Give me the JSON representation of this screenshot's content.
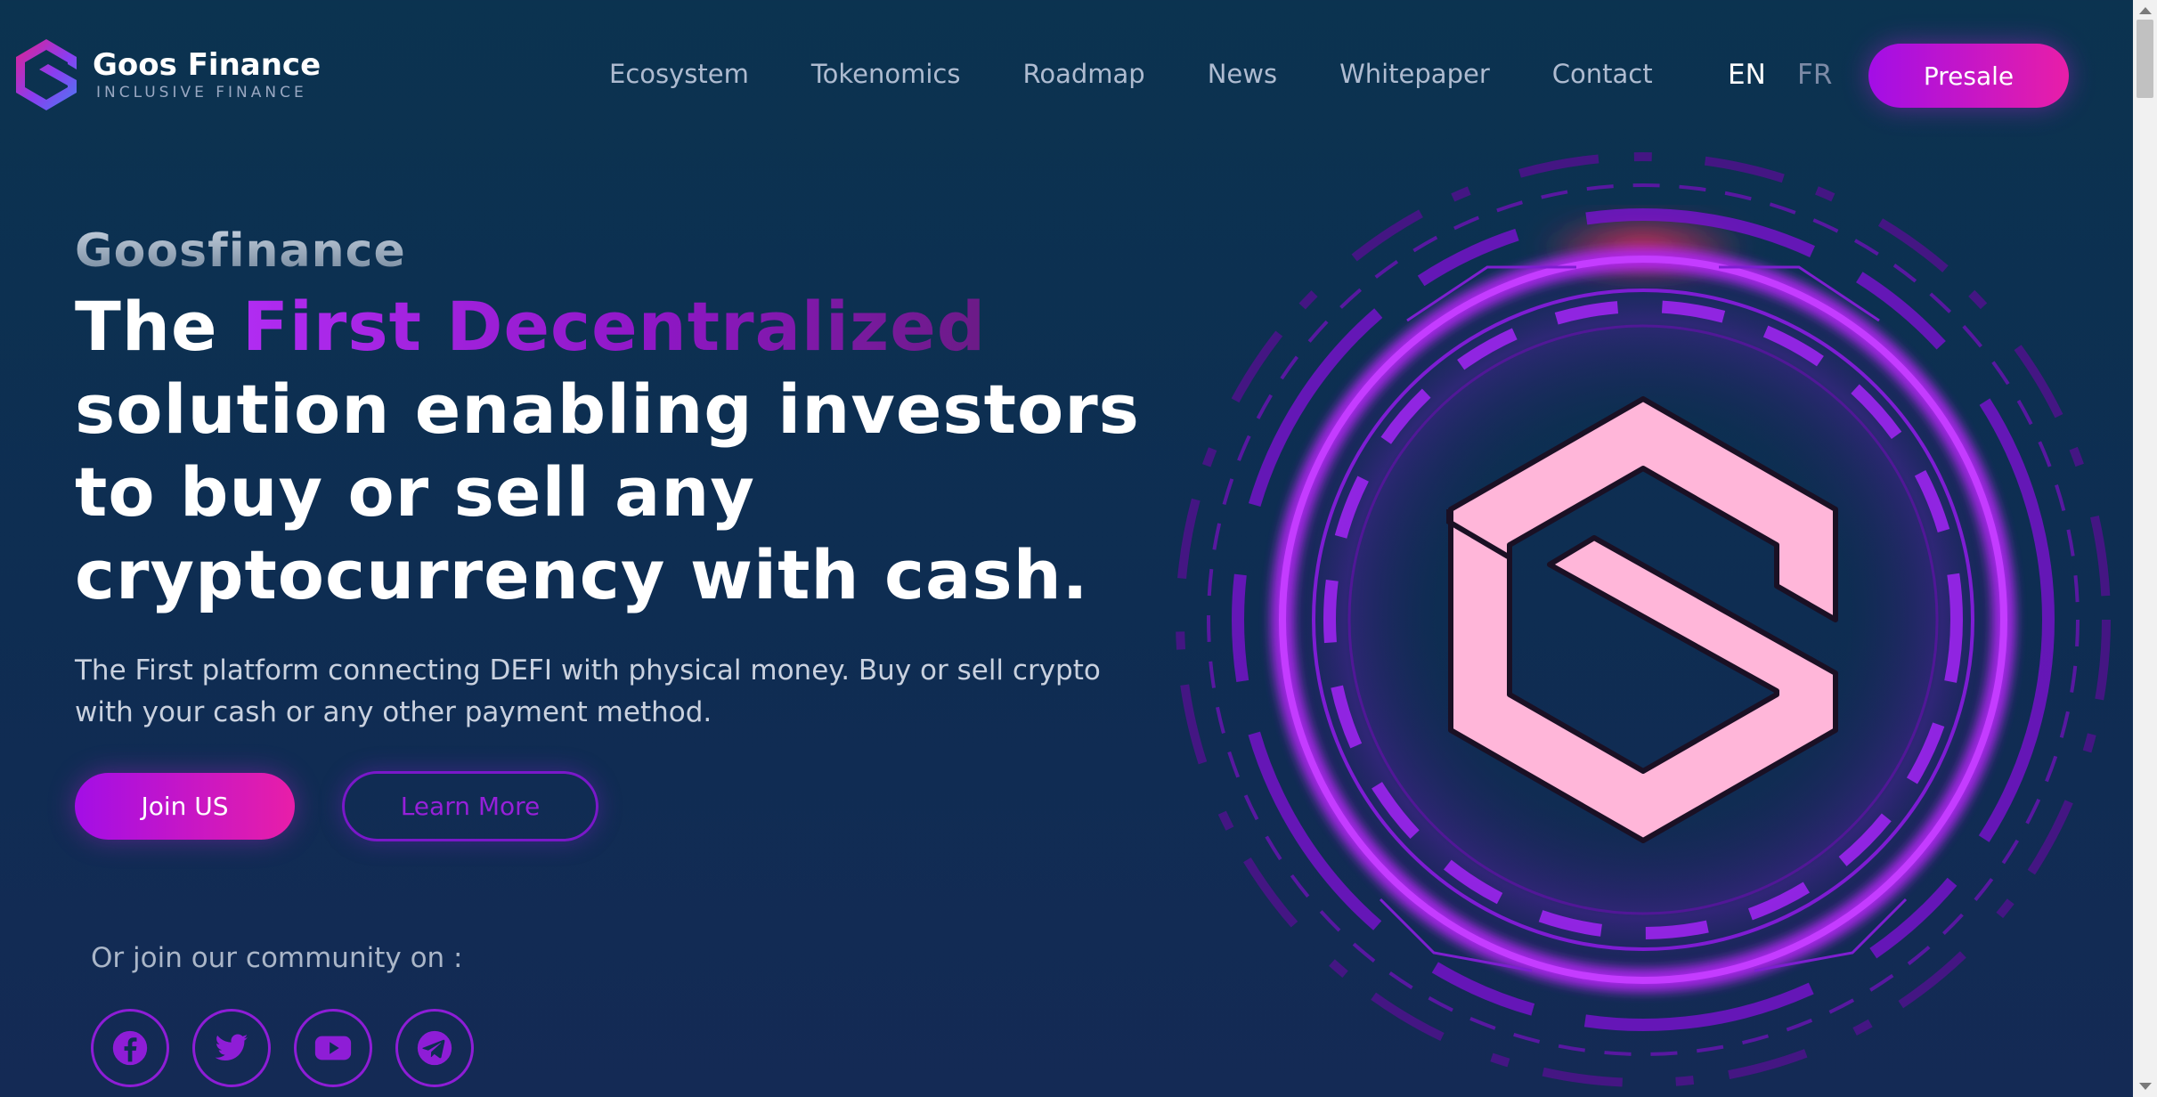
{
  "brand": {
    "name": "Goos Finance",
    "tagline": "INCLUSIVE FINANCE"
  },
  "nav": {
    "items": [
      {
        "label": "Ecosystem"
      },
      {
        "label": "Tokenomics"
      },
      {
        "label": "Roadmap"
      },
      {
        "label": "News"
      },
      {
        "label": "Whitepaper"
      },
      {
        "label": "Contact"
      }
    ],
    "languages": [
      {
        "label": "EN",
        "active": true
      },
      {
        "label": "FR",
        "active": false
      }
    ],
    "cta_label": "Presale"
  },
  "hero": {
    "eyebrow": "Goosfinance",
    "headline_prefix": "The ",
    "headline_accent": "First Decentralized",
    "headline_rest": " solution enabling investors to buy or sell any cryptocurrency with cash.",
    "subtext": "The First platform connecting DEFI with physical money. Buy or sell crypto with your cash or any other payment method.",
    "primary_button": "Join US",
    "secondary_button": "Learn More",
    "community_label": "Or join our community on :"
  },
  "socials": [
    {
      "icon": "facebook-icon"
    },
    {
      "icon": "twitter-icon"
    },
    {
      "icon": "youtube-icon"
    },
    {
      "icon": "telegram-icon"
    }
  ],
  "colors": {
    "background": "#0b3350",
    "accent_purple": "#a30ee6",
    "accent_pink": "#e81ea8",
    "logo_pink": "#ffb6d9"
  }
}
